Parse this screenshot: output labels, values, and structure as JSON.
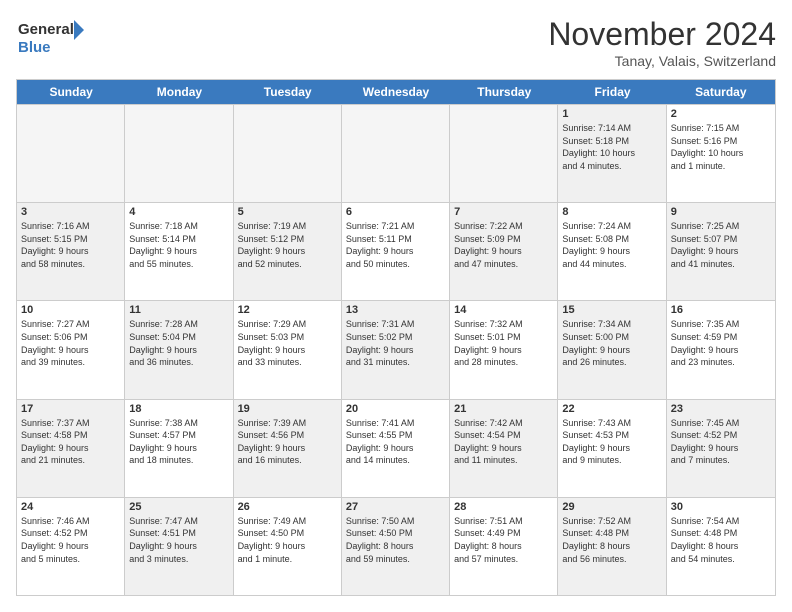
{
  "logo": {
    "line1": "General",
    "line2": "Blue"
  },
  "title": "November 2024",
  "location": "Tanay, Valais, Switzerland",
  "days_of_week": [
    "Sunday",
    "Monday",
    "Tuesday",
    "Wednesday",
    "Thursday",
    "Friday",
    "Saturday"
  ],
  "rows": [
    [
      {
        "day": "",
        "info": "",
        "empty": true
      },
      {
        "day": "",
        "info": "",
        "empty": true
      },
      {
        "day": "",
        "info": "",
        "empty": true
      },
      {
        "day": "",
        "info": "",
        "empty": true
      },
      {
        "day": "",
        "info": "",
        "empty": true
      },
      {
        "day": "1",
        "info": "Sunrise: 7:14 AM\nSunset: 5:18 PM\nDaylight: 10 hours\nand 4 minutes.",
        "shaded": true
      },
      {
        "day": "2",
        "info": "Sunrise: 7:15 AM\nSunset: 5:16 PM\nDaylight: 10 hours\nand 1 minute.",
        "shaded": false
      }
    ],
    [
      {
        "day": "3",
        "info": "Sunrise: 7:16 AM\nSunset: 5:15 PM\nDaylight: 9 hours\nand 58 minutes.",
        "shaded": true
      },
      {
        "day": "4",
        "info": "Sunrise: 7:18 AM\nSunset: 5:14 PM\nDaylight: 9 hours\nand 55 minutes.",
        "shaded": false
      },
      {
        "day": "5",
        "info": "Sunrise: 7:19 AM\nSunset: 5:12 PM\nDaylight: 9 hours\nand 52 minutes.",
        "shaded": true
      },
      {
        "day": "6",
        "info": "Sunrise: 7:21 AM\nSunset: 5:11 PM\nDaylight: 9 hours\nand 50 minutes.",
        "shaded": false
      },
      {
        "day": "7",
        "info": "Sunrise: 7:22 AM\nSunset: 5:09 PM\nDaylight: 9 hours\nand 47 minutes.",
        "shaded": true
      },
      {
        "day": "8",
        "info": "Sunrise: 7:24 AM\nSunset: 5:08 PM\nDaylight: 9 hours\nand 44 minutes.",
        "shaded": false
      },
      {
        "day": "9",
        "info": "Sunrise: 7:25 AM\nSunset: 5:07 PM\nDaylight: 9 hours\nand 41 minutes.",
        "shaded": true
      }
    ],
    [
      {
        "day": "10",
        "info": "Sunrise: 7:27 AM\nSunset: 5:06 PM\nDaylight: 9 hours\nand 39 minutes.",
        "shaded": false
      },
      {
        "day": "11",
        "info": "Sunrise: 7:28 AM\nSunset: 5:04 PM\nDaylight: 9 hours\nand 36 minutes.",
        "shaded": true
      },
      {
        "day": "12",
        "info": "Sunrise: 7:29 AM\nSunset: 5:03 PM\nDaylight: 9 hours\nand 33 minutes.",
        "shaded": false
      },
      {
        "day": "13",
        "info": "Sunrise: 7:31 AM\nSunset: 5:02 PM\nDaylight: 9 hours\nand 31 minutes.",
        "shaded": true
      },
      {
        "day": "14",
        "info": "Sunrise: 7:32 AM\nSunset: 5:01 PM\nDaylight: 9 hours\nand 28 minutes.",
        "shaded": false
      },
      {
        "day": "15",
        "info": "Sunrise: 7:34 AM\nSunset: 5:00 PM\nDaylight: 9 hours\nand 26 minutes.",
        "shaded": true
      },
      {
        "day": "16",
        "info": "Sunrise: 7:35 AM\nSunset: 4:59 PM\nDaylight: 9 hours\nand 23 minutes.",
        "shaded": false
      }
    ],
    [
      {
        "day": "17",
        "info": "Sunrise: 7:37 AM\nSunset: 4:58 PM\nDaylight: 9 hours\nand 21 minutes.",
        "shaded": true
      },
      {
        "day": "18",
        "info": "Sunrise: 7:38 AM\nSunset: 4:57 PM\nDaylight: 9 hours\nand 18 minutes.",
        "shaded": false
      },
      {
        "day": "19",
        "info": "Sunrise: 7:39 AM\nSunset: 4:56 PM\nDaylight: 9 hours\nand 16 minutes.",
        "shaded": true
      },
      {
        "day": "20",
        "info": "Sunrise: 7:41 AM\nSunset: 4:55 PM\nDaylight: 9 hours\nand 14 minutes.",
        "shaded": false
      },
      {
        "day": "21",
        "info": "Sunrise: 7:42 AM\nSunset: 4:54 PM\nDaylight: 9 hours\nand 11 minutes.",
        "shaded": true
      },
      {
        "day": "22",
        "info": "Sunrise: 7:43 AM\nSunset: 4:53 PM\nDaylight: 9 hours\nand 9 minutes.",
        "shaded": false
      },
      {
        "day": "23",
        "info": "Sunrise: 7:45 AM\nSunset: 4:52 PM\nDaylight: 9 hours\nand 7 minutes.",
        "shaded": true
      }
    ],
    [
      {
        "day": "24",
        "info": "Sunrise: 7:46 AM\nSunset: 4:52 PM\nDaylight: 9 hours\nand 5 minutes.",
        "shaded": false
      },
      {
        "day": "25",
        "info": "Sunrise: 7:47 AM\nSunset: 4:51 PM\nDaylight: 9 hours\nand 3 minutes.",
        "shaded": true
      },
      {
        "day": "26",
        "info": "Sunrise: 7:49 AM\nSunset: 4:50 PM\nDaylight: 9 hours\nand 1 minute.",
        "shaded": false
      },
      {
        "day": "27",
        "info": "Sunrise: 7:50 AM\nSunset: 4:50 PM\nDaylight: 8 hours\nand 59 minutes.",
        "shaded": true
      },
      {
        "day": "28",
        "info": "Sunrise: 7:51 AM\nSunset: 4:49 PM\nDaylight: 8 hours\nand 57 minutes.",
        "shaded": false
      },
      {
        "day": "29",
        "info": "Sunrise: 7:52 AM\nSunset: 4:48 PM\nDaylight: 8 hours\nand 56 minutes.",
        "shaded": true
      },
      {
        "day": "30",
        "info": "Sunrise: 7:54 AM\nSunset: 4:48 PM\nDaylight: 8 hours\nand 54 minutes.",
        "shaded": false
      }
    ]
  ]
}
